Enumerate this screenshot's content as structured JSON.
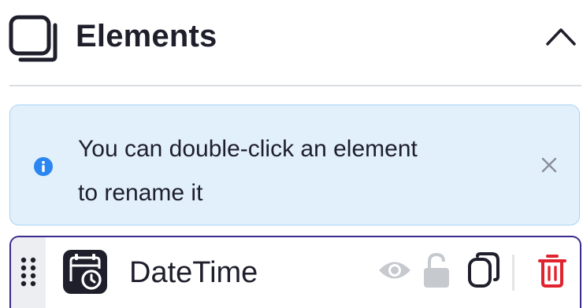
{
  "panel": {
    "title": "Elements",
    "header_icon": "layers-icon",
    "collapse_icon": "chevron-up-icon"
  },
  "info_banner": {
    "icon": "info-icon",
    "text_line1": "You can double-click an element",
    "text_line2": "to rename it",
    "close_icon": "close-icon"
  },
  "elements": [
    {
      "name": "DateTime",
      "type_icon": "calendar-clock-icon",
      "actions": {
        "visibility_icon": "eye-icon",
        "lock_icon": "unlock-icon",
        "duplicate_icon": "copy-icon",
        "delete_icon": "trash-icon"
      }
    }
  ],
  "colors": {
    "text": "#1e1f2b",
    "banner_background": "#e2f0fc",
    "banner_border": "#a9d3f2",
    "info_icon": "#2b86f0",
    "selected_border": "#3b2a8f",
    "muted_icon": "#c6c9ce",
    "delete_icon": "#e0242f",
    "divider": "#dadde3"
  }
}
